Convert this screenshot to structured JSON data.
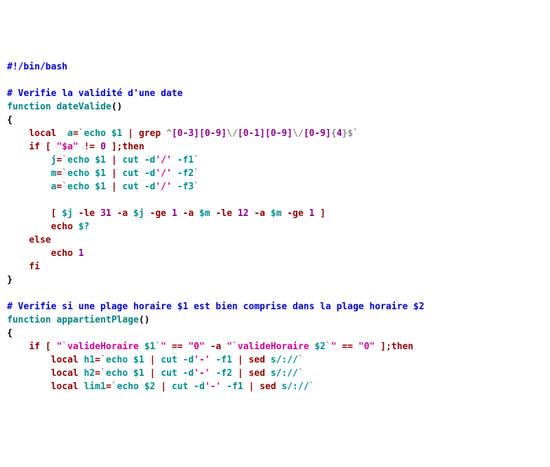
{
  "l1_shebang": "#!/bin/bash",
  "l3_cmt": "# Verifie la validité d'une date",
  "l4_fn": "function",
  "l4_name": "dateValide",
  "l4_paren": "()",
  "l5_brace": "{",
  "l6_local": "local",
  "l6_var": "a",
  "l6_eq": "=",
  "l6_bt1": "`",
  "l6_echo": "echo",
  "l6_arg": "$1",
  "l6_pipe": "|",
  "l6_grep": "grep",
  "l6_caret": "^",
  "l6_r1": "[0-3][0-9]",
  "l6_esc1": "\\/",
  "l6_r2": "[0-1][0-9]",
  "l6_esc2": "\\/",
  "l6_r3": "[0-9]",
  "l6_q1": "{",
  "l6_q2": "4",
  "l6_q3": "}",
  "l6_dollar": "$",
  "l6_bt2": "`",
  "l7_if": "if [",
  "l7_sp": " ",
  "l7_s1": "\"$a\"",
  "l7_ne": "!=",
  "l7_zero": "0",
  "l7_end": "];then",
  "l8_var": "j",
  "l8_eq": "=",
  "l8_bt1": "`",
  "l8_echo": "echo",
  "l8_arg": "$1",
  "l8_pipe": "|",
  "l8_cut": "cut",
  "l8_d": "-d",
  "l8_slash": "'/'",
  "l8_f": "-f1",
  "l8_bt2": "`",
  "l9_var": "m",
  "l9_f": "-f2",
  "l10_var": "a",
  "l10_f": "-f3",
  "l12_lb": "[",
  "l12_j": "$j",
  "l12_le": "-le",
  "l12_31": "31",
  "l12_a": "-a",
  "l12_ge": "-ge",
  "l12_1": "1",
  "l12_m": "$m",
  "l12_12": "12",
  "l12_rb": "]",
  "l13_echo": "echo",
  "l13_arg": "$?",
  "l14_else": "else",
  "l15_echo": "echo",
  "l15_1": "1",
  "l16_fi": "fi",
  "l17_brace": "}",
  "l19_cmt": "# Verifie si une plage horaire $1 est bien comprise dans la plage horaire $2",
  "l20_fn": "function",
  "l20_name": "appartientPlage",
  "l20_paren": "()",
  "l21_brace": "{",
  "l22_if": "if [",
  "l22_q1": "\"",
  "l22_bt1": "`",
  "l22_vh": "valideHoraire",
  "l22_a1": "$1",
  "l22_bt2": "`",
  "l22_q2": "\"",
  "l22_eq": "==",
  "l22_zero": "\"0\"",
  "l22_da": "-a",
  "l22_a2": "$2",
  "l22_end": "];then",
  "l23_local": "local",
  "l23_var": "h1",
  "l23_eq": "=",
  "l23_bt1": "`",
  "l23_echo": "echo",
  "l23_arg": "$1",
  "l23_pipe": "|",
  "l23_cut": "cut",
  "l23_d": "-d",
  "l23_dash": "'-'",
  "l23_f": "-f1",
  "l23_sed": "sed",
  "l23_re": "s/://",
  "l23_bt2": "`",
  "l24_var": "h2",
  "l24_f": "-f2",
  "l25_var": "lim1",
  "l25_arg": "$2",
  "l25_f": "-f1"
}
